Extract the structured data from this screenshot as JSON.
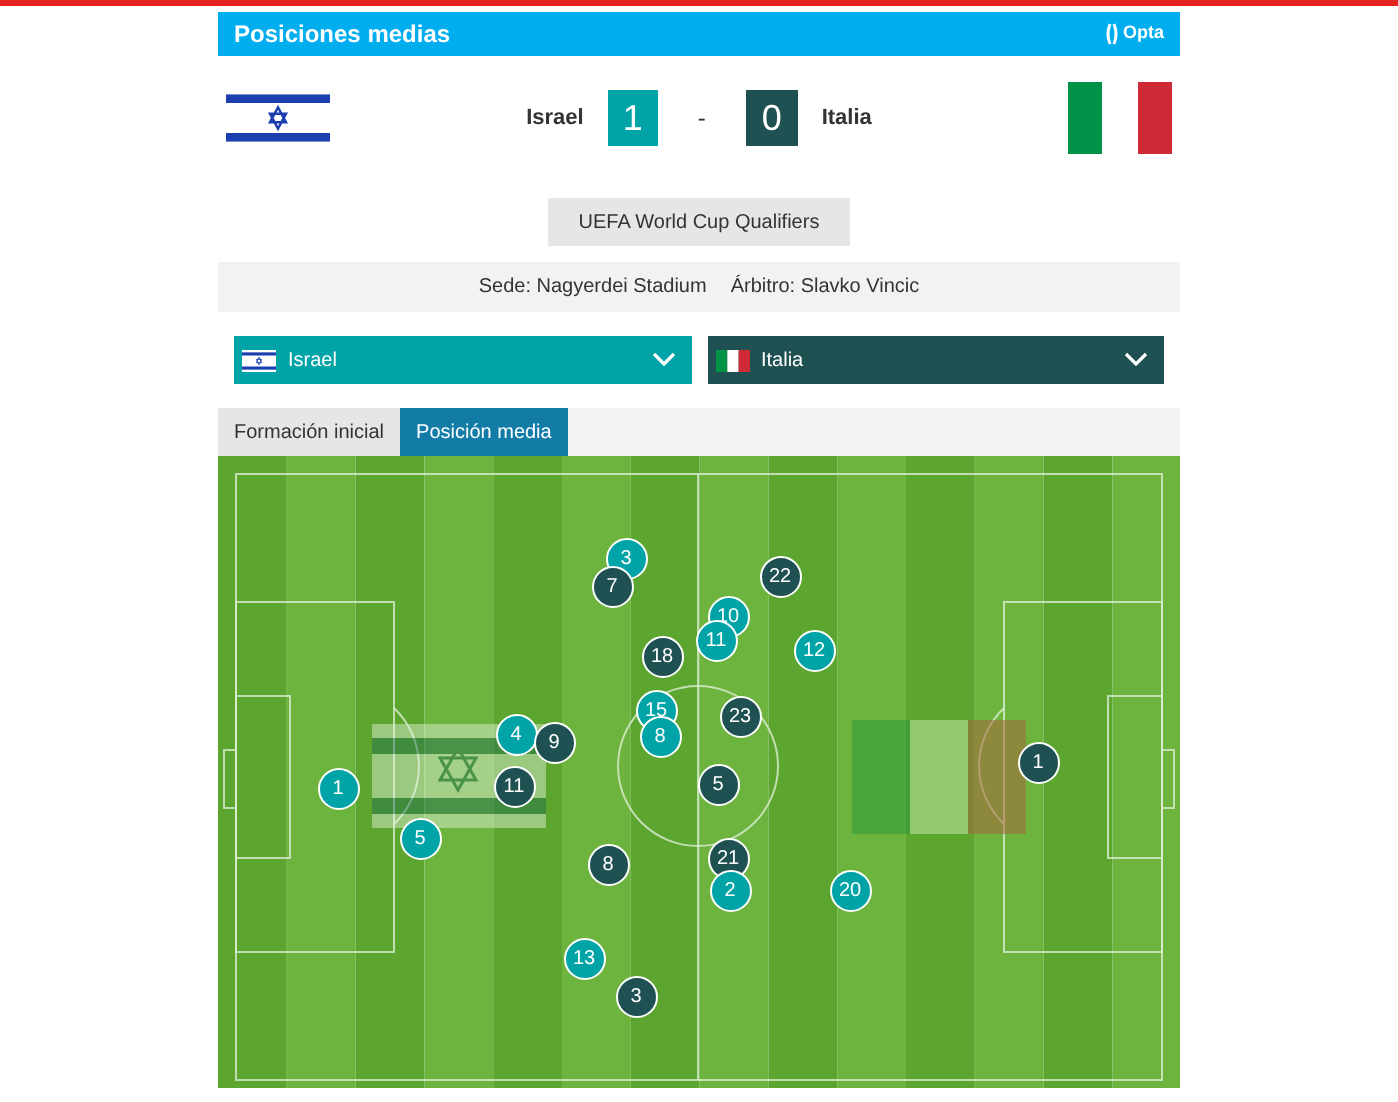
{
  "header": {
    "title": "Posiciones medias",
    "brand": "Opta"
  },
  "match": {
    "home": "Israel",
    "home_score": "1",
    "separator": "-",
    "away_score": "0",
    "away": "Italia"
  },
  "competition": "UEFA World Cup Qualifiers",
  "info": {
    "venue": "Sede: Nagyerdei Stadium",
    "referee": "Árbitro: Slavko Vincic"
  },
  "team_selects": [
    {
      "label": "Israel",
      "kind": "home"
    },
    {
      "label": "Italia",
      "kind": "away"
    }
  ],
  "tabs": [
    {
      "label": "Formación inicial",
      "selected": false
    },
    {
      "label": "Posición media",
      "selected": true
    }
  ],
  "players": [
    {
      "number": "3",
      "kind": "home"
    },
    {
      "number": "7",
      "kind": "away"
    },
    {
      "number": "22",
      "kind": "away"
    },
    {
      "number": "10",
      "kind": "home"
    },
    {
      "number": "11",
      "kind": "home"
    },
    {
      "number": "18",
      "kind": "away"
    },
    {
      "number": "12",
      "kind": "home"
    },
    {
      "number": "15",
      "kind": "home"
    },
    {
      "number": "8",
      "kind": "home"
    },
    {
      "number": "23",
      "kind": "away"
    },
    {
      "number": "4",
      "kind": "home"
    },
    {
      "number": "9",
      "kind": "away"
    },
    {
      "number": "1",
      "kind": "away"
    },
    {
      "number": "1",
      "kind": "home"
    },
    {
      "number": "11",
      "kind": "away"
    },
    {
      "number": "5",
      "kind": "away"
    },
    {
      "number": "5",
      "kind": "home"
    },
    {
      "number": "8",
      "kind": "away"
    },
    {
      "number": "21",
      "kind": "away"
    },
    {
      "number": "2",
      "kind": "home"
    },
    {
      "number": "20",
      "kind": "home"
    },
    {
      "number": "13",
      "kind": "home"
    },
    {
      "number": "3",
      "kind": "away"
    }
  ]
}
